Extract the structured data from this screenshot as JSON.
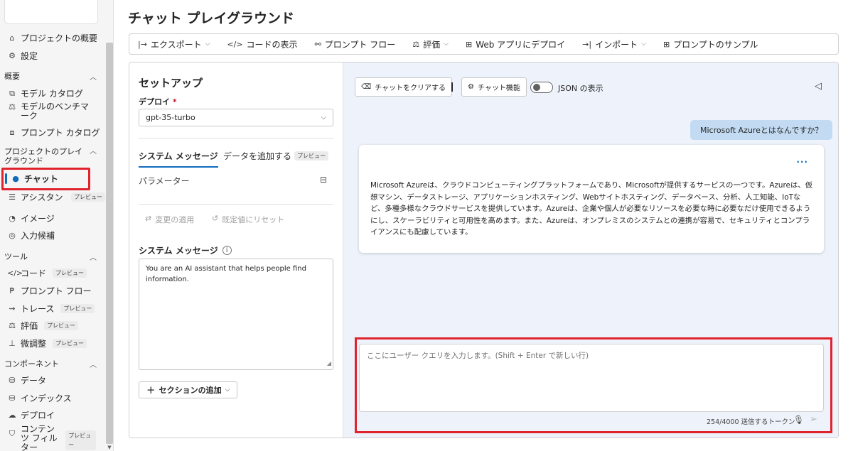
{
  "page": {
    "title": "チャット プレイグラウンド"
  },
  "sidebar": {
    "top_items": [
      {
        "label": "プロジェクトの概要",
        "icon": "home-icon"
      },
      {
        "label": "設定",
        "icon": "gear-icon"
      }
    ],
    "sections": {
      "overview": {
        "label": "概要",
        "items": [
          {
            "label": "モデル カタログ",
            "icon": "catalog-icon"
          },
          {
            "label": "モデルのベンチマーク",
            "icon": "scale-icon"
          },
          {
            "label": "プロンプト カタログ",
            "icon": "prompt-catalog-icon"
          }
        ]
      },
      "playground": {
        "label": "プロジェクトのプレイグラウンド",
        "items": [
          {
            "label": "チャット",
            "icon": "chat-icon",
            "active": true
          },
          {
            "label": "アシスタント",
            "icon": "assistant-icon",
            "badge": "プレビュー"
          },
          {
            "label": "イメージ",
            "icon": "image-icon"
          },
          {
            "label": "入力候補",
            "icon": "completion-icon"
          }
        ]
      },
      "tools": {
        "label": "ツール",
        "items": [
          {
            "label": "コード",
            "icon": "code-icon",
            "badge": "プレビュー"
          },
          {
            "label": "プロンプト フロー",
            "icon": "flow-icon"
          },
          {
            "label": "トレース",
            "icon": "trace-icon",
            "badge": "プレビュー"
          },
          {
            "label": "評価",
            "icon": "scale-icon",
            "badge": "プレビュー"
          },
          {
            "label": "微調整",
            "icon": "flask-icon",
            "badge": "プレビュー"
          }
        ]
      },
      "components": {
        "label": "コンポーネント",
        "items": [
          {
            "label": "データ",
            "icon": "database-icon"
          },
          {
            "label": "インデックス",
            "icon": "index-icon"
          },
          {
            "label": "デプロイ",
            "icon": "cloud-icon"
          },
          {
            "label": "コンテンツ フィルター",
            "icon": "shield-icon",
            "badge": "プレビュー"
          }
        ]
      }
    }
  },
  "toolbar": {
    "export": "エクスポート",
    "view_code": "コードの表示",
    "prompt_flow": "プロンプト フロー",
    "evaluate": "評価",
    "deploy_web": "Web アプリにデプロイ",
    "import": "インポート",
    "samples": "プロンプトのサンプル"
  },
  "setup": {
    "title": "セットアップ",
    "deploy_label": "デプロイ",
    "deploy_required": "*",
    "deploy_value": "gpt-35-turbo",
    "tab_system": "システム メッセージ",
    "tab_data": "データを追加する",
    "tab_data_badge": "プレビュー",
    "params_label": "パラメーター",
    "apply_label": "変更の適用",
    "reset_label": "既定値にリセット",
    "sysmsg_label": "システム メッセージ",
    "sysmsg_value": "You are an AI assistant that helps people find information.",
    "add_section_label": "セクションの追加"
  },
  "chat": {
    "clear_label": "チャットをクリアする",
    "features_label": "チャット機能",
    "json_label": "JSON の表示",
    "json_toggle_on": false,
    "user_message": "Microsoft Azureとはなんですか？",
    "assistant_more": "...",
    "assistant_message": "Microsoft Azureは、クラウドコンピューティングプラットフォームであり、Microsoftが提供するサービスの一つです。Azureは、仮想マシン、データストレージ、アプリケーションホスティング、Webサイトホスティング、データベース、分析、人工知能、IoTなど、多種多様なクラウドサービスを提供しています。Azureは、企業や個人が必要なリソースを必要な時に必要なだけ使用できるようにし、スケーラビリティと可用性を高めます。また、Azureは、オンプレミスのシステムとの連携が容易で、セキュリティとコンプライアンスにも配慮しています。",
    "input_placeholder": "ここにユーザー クエリを入力します。(Shift + Enter で新しい行)",
    "token_count": "254/4000 送信するトークン"
  },
  "colors": {
    "accent": "#0f6cbd",
    "highlight": "#e0232d",
    "chat_bg": "#eef3fb",
    "user_bubble": "#c2dbf2"
  }
}
